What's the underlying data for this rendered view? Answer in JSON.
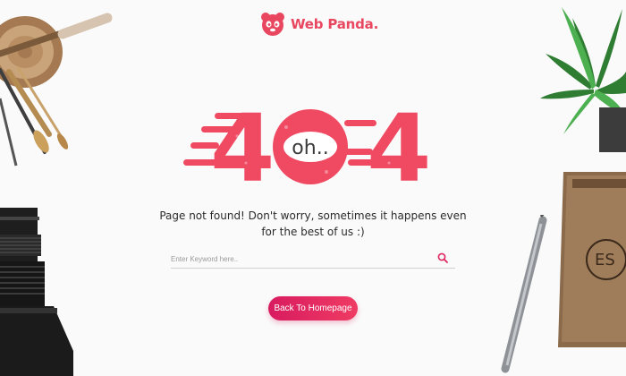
{
  "brand": {
    "name": "Web Panda."
  },
  "error": {
    "code_left": "4",
    "code_right": "4",
    "bubble": "oh.."
  },
  "message": {
    "line1": "Page not found! Don't worry, sometimes it happens even",
    "line2": "for the best of us :)"
  },
  "search": {
    "placeholder": "Enter Keyword here..",
    "value": ""
  },
  "button": {
    "label": "Back To Homepage"
  },
  "colors": {
    "accent": "#f04a63",
    "brand": "#e8475f",
    "button": "#e91e63",
    "background": "#fafafa"
  },
  "icons": {
    "search": "search-icon",
    "logo": "panda-icon"
  }
}
